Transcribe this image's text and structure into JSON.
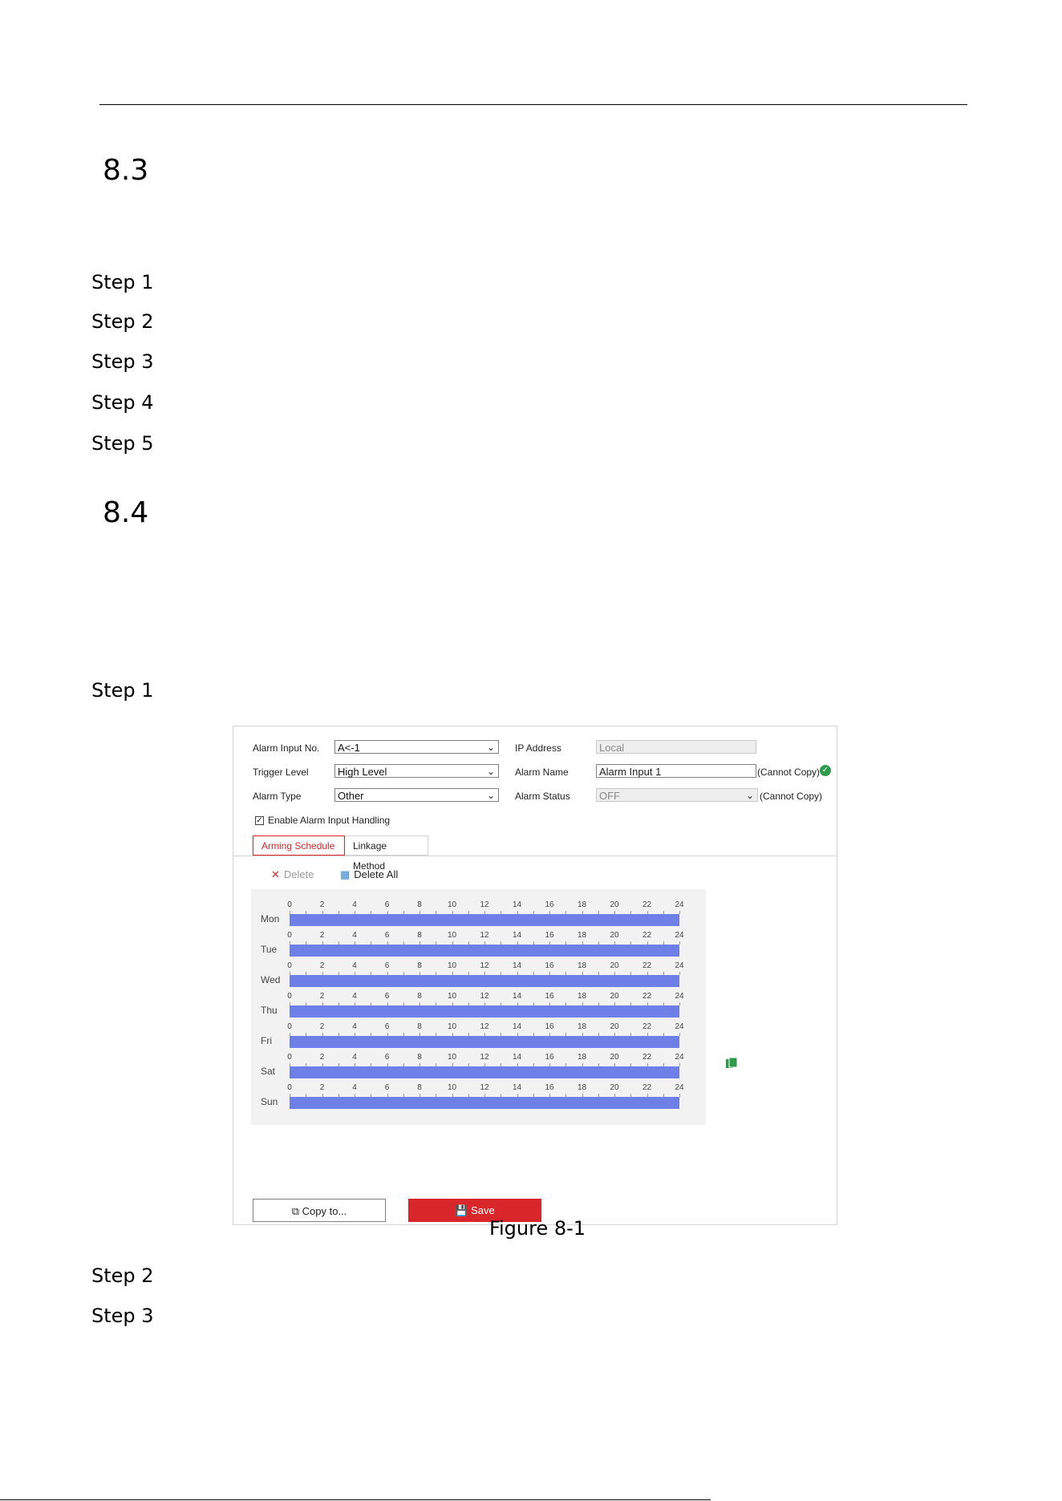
{
  "sections": [
    {
      "number": "8.3",
      "steps": [
        "Step 1",
        "Step 2",
        "Step 3",
        "Step 4",
        "Step 5"
      ]
    },
    {
      "number": "8.4",
      "steps_before_figure": [
        "Step 1"
      ],
      "steps_after_figure": [
        "Step 2",
        "Step 3"
      ]
    }
  ],
  "figure_caption": "Figure 8-1",
  "form": {
    "alarm_input_no": {
      "label": "Alarm Input No.",
      "value": "A<-1"
    },
    "ip_address": {
      "label": "IP Address",
      "value": "Local"
    },
    "trigger_level": {
      "label": "Trigger Level",
      "value": "High Level"
    },
    "alarm_name": {
      "label": "Alarm Name",
      "value": "Alarm Input 1",
      "note": "(Cannot Copy)"
    },
    "alarm_type": {
      "label": "Alarm Type",
      "value": "Other"
    },
    "alarm_status": {
      "label": "Alarm Status",
      "value": "OFF",
      "note": "(Cannot Copy)"
    },
    "enable_handling": {
      "label": "Enable Alarm Input Handling",
      "checked": true
    }
  },
  "tabs": [
    "Arming Schedule",
    "Linkage Method"
  ],
  "toolbar": {
    "delete": "Delete",
    "delete_all": "Delete All"
  },
  "schedule": {
    "days": [
      "Mon",
      "Tue",
      "Wed",
      "Thu",
      "Fri",
      "Sat",
      "Sun"
    ],
    "hour_ticks": [
      "0",
      "2",
      "4",
      "6",
      "8",
      "10",
      "12",
      "14",
      "16",
      "18",
      "20",
      "22",
      "24"
    ],
    "bar_color": "#6f7fe8"
  },
  "buttons": {
    "copy_to": "Copy to...",
    "save": "Save"
  },
  "colors": {
    "accent": "#d9262b",
    "ok": "#2e9b4a"
  }
}
